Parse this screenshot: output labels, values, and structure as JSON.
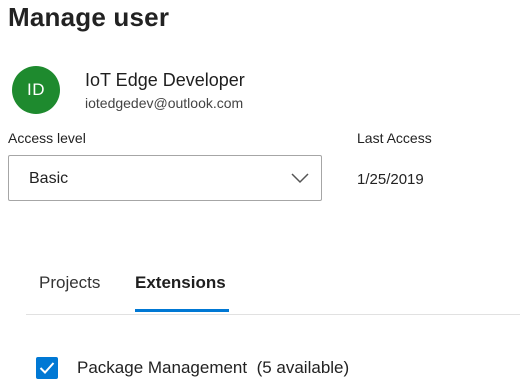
{
  "page": {
    "title": "Manage user"
  },
  "user": {
    "initials": "ID",
    "name": "IoT Edge Developer",
    "email": "iotedgedev@outlook.com",
    "avatar_color": "#1e8a2e"
  },
  "access": {
    "label": "Access level",
    "selected_value": "Basic",
    "dropdown_icon": "chevron-down-icon"
  },
  "last_access": {
    "label": "Last Access",
    "value": "1/25/2019"
  },
  "tabs": [
    {
      "label": "Projects",
      "selected": false
    },
    {
      "label": "Extensions",
      "selected": true
    }
  ],
  "extensions": {
    "items": [
      {
        "name": "Package Management",
        "availability": "(5 available)",
        "checked": true
      }
    ]
  },
  "colors": {
    "accent": "#0078d4",
    "avatar": "#1e8a2e"
  }
}
